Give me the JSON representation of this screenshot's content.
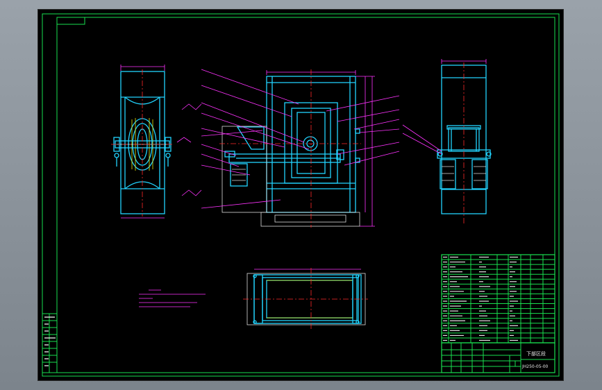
{
  "drawing": {
    "title_block_name": "下部区段",
    "drawing_number": "JH250-05-00"
  },
  "colors": {
    "frame": "#19e04f",
    "outline": "#22d4ff",
    "leader": "#ff33ff",
    "centerline": "#ff2a2a",
    "background": "#000000",
    "window": "#8c939b"
  }
}
